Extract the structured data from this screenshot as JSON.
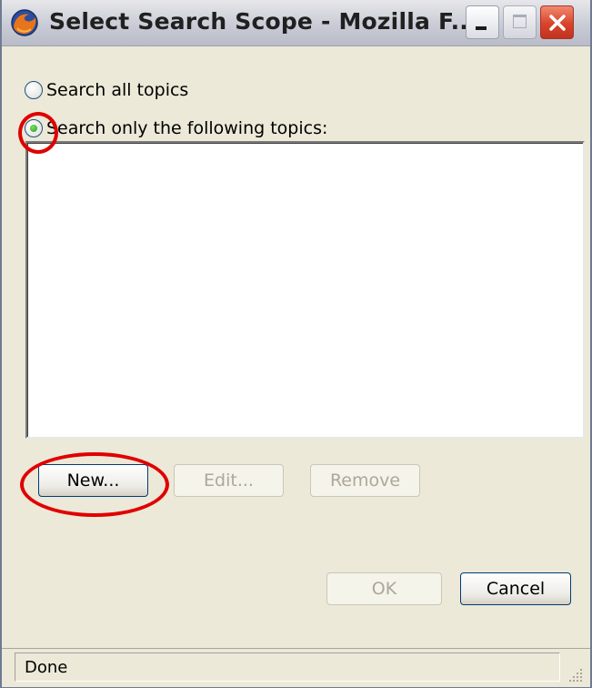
{
  "window": {
    "title": "Select Search Scope - Mozilla F..."
  },
  "scope": {
    "all_topics_label": "Search all topics",
    "all_topics_checked": false,
    "following_topics_label": "Search only the following topics:",
    "following_topics_checked": true
  },
  "topics": [],
  "buttons": {
    "new": {
      "label": "New...",
      "enabled": true
    },
    "edit": {
      "label": "Edit...",
      "enabled": false
    },
    "remove": {
      "label": "Remove",
      "enabled": false
    },
    "ok": {
      "label": "OK",
      "enabled": false
    },
    "cancel": {
      "label": "Cancel",
      "enabled": true
    }
  },
  "statusbar": {
    "text": "Done"
  },
  "colors": {
    "annotation": "#e00000",
    "window_face": "#ece9d8",
    "disabled_text": "#aca899"
  }
}
